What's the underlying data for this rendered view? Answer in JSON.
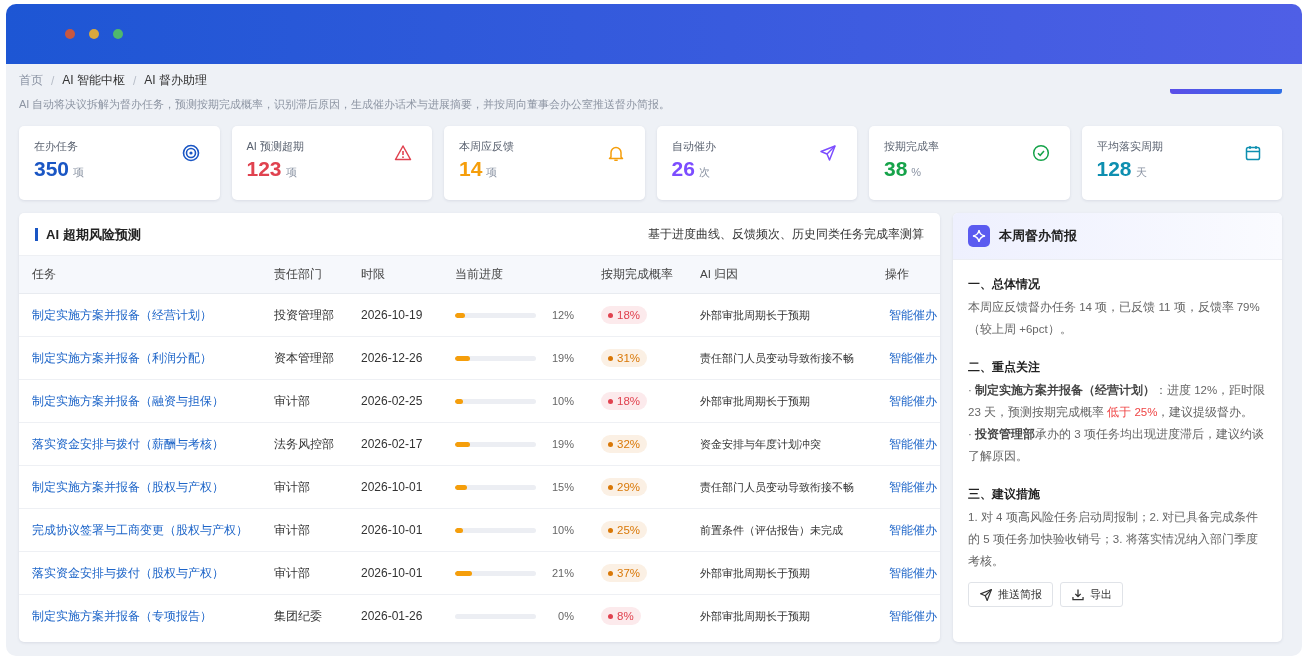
{
  "breadcrumb": [
    {
      "label": "首页"
    },
    {
      "separator": "/",
      "label": "AI 智能中枢"
    },
    {
      "separator": "/",
      "label": "AI 督办助理"
    }
  ],
  "description": "AI 自动将决议拆解为督办任务，预测按期完成概率，识别滞后原因，生成催办话术与进展摘要，并按周向董事会办公室推送督办简报。",
  "stats": [
    {
      "label": "在办任务",
      "value": "350",
      "unit": "项",
      "kind": "target",
      "color": "#1a56c4"
    },
    {
      "label": "AI 预测超期",
      "value": "123",
      "unit": "项",
      "kind": "warning",
      "color": "#e0424f"
    },
    {
      "label": "本周应反馈",
      "value": "14",
      "unit": "项",
      "kind": "bell",
      "color": "#f59e0b"
    },
    {
      "label": "自动催办",
      "value": "26",
      "unit": "次",
      "kind": "send",
      "color": "#7c4dff"
    },
    {
      "label": "按期完成率",
      "value": "38",
      "unit": "%",
      "kind": "check",
      "color": "#16a34a"
    },
    {
      "label": "平均落实周期",
      "value": "128",
      "unit": "天",
      "kind": "calendar",
      "color": "#0e8fb0"
    }
  ],
  "risk_table": {
    "title": "AI 超期风险预测",
    "note": "基于进度曲线、反馈频次、历史同类任务完成率测算",
    "columns": [
      "任务",
      "责任部门",
      "时限",
      "当前进度",
      "按期完成概率",
      "AI 归因",
      "操作"
    ],
    "rows": [
      {
        "task": "制定实施方案并报备（经营计划）",
        "dept": "投资管理部",
        "deadline": "2026-10-19",
        "level": 0.12,
        "progress": "12%",
        "probability": "18%",
        "color": "#e0424f",
        "reason": "外部审批周期长于预期",
        "action": "智能催办"
      },
      {
        "task": "制定实施方案并报备（利润分配）",
        "dept": "资本管理部",
        "deadline": "2026-12-26",
        "level": 0.19,
        "progress": "19%",
        "probability": "31%",
        "color": "#d97706",
        "reason": "责任部门人员变动导致衔接不畅",
        "action": "智能催办"
      },
      {
        "task": "制定实施方案并报备（融资与担保）",
        "dept": "审计部",
        "deadline": "2026-02-25",
        "level": 0.1,
        "progress": "10%",
        "probability": "18%",
        "color": "#e0424f",
        "reason": "外部审批周期长于预期",
        "action": "智能催办"
      },
      {
        "task": "落实资金安排与拨付（薪酬与考核）",
        "dept": "法务风控部",
        "deadline": "2026-02-17",
        "level": 0.19,
        "progress": "19%",
        "probability": "32%",
        "color": "#d97706",
        "reason": "资金安排与年度计划冲突",
        "action": "智能催办"
      },
      {
        "task": "制定实施方案并报备（股权与产权）",
        "dept": "审计部",
        "deadline": "2026-10-01",
        "level": 0.15,
        "progress": "15%",
        "probability": "29%",
        "color": "#d97706",
        "reason": "责任部门人员变动导致衔接不畅",
        "action": "智能催办"
      },
      {
        "task": "完成协议签署与工商变更（股权与产权）",
        "dept": "审计部",
        "deadline": "2026-10-01",
        "level": 0.1,
        "progress": "10%",
        "probability": "25%",
        "color": "#d97706",
        "reason": "前置条件（评估报告）未完成",
        "action": "智能催办"
      },
      {
        "task": "落实资金安排与拨付（股权与产权）",
        "dept": "审计部",
        "deadline": "2026-10-01",
        "level": 0.21,
        "progress": "21%",
        "probability": "37%",
        "color": "#d97706",
        "reason": "外部审批周期长于预期",
        "action": "智能催办"
      },
      {
        "task": "制定实施方案并报备（专项报告）",
        "dept": "集团纪委",
        "deadline": "2026-01-26",
        "level": 0,
        "progress": "0%",
        "probability": "8%",
        "color": "#e0424f",
        "reason": "外部审批周期长于预期",
        "action": "智能催办"
      }
    ]
  },
  "briefing": {
    "title": "本周督办简报",
    "sections": [
      {
        "heading": "一、总体情况",
        "paragraphs": [
          [
            {
              "text": "本周应反馈督办任务 14 项，已反馈 11 项，反馈率 79%（较上周 +6pct）。",
              "highlight": false
            }
          ]
        ]
      },
      {
        "heading": "二、重点关注",
        "paragraphs": [
          [
            {
              "text": "· **制定实施方案并报备（经营计划）**：进度 12%，距时限 23 天，预测按期完成概率 ",
              "highlight": false
            },
            {
              "text": "低于 25%",
              "highlight": true
            },
            {
              "text": "，建议提级督办。",
              "highlight": false
            }
          ],
          [
            {
              "text": "· **投资管理部**承办的 3 项任务均出现进度滞后，建议约谈了解原因。",
              "highlight": false
            }
          ]
        ]
      },
      {
        "heading": "三、建议措施",
        "paragraphs": [
          [
            {
              "text": "1. 对 4 项高风险任务启动周报制；2. 对已具备完成条件的 5 项任务加快验收销号；3. 将落实情况纳入部门季度考核。",
              "highlight": false
            }
          ]
        ]
      }
    ],
    "buttons": [
      {
        "label": "推送简报",
        "kind": "send"
      },
      {
        "label": "导出",
        "kind": "download"
      }
    ]
  }
}
